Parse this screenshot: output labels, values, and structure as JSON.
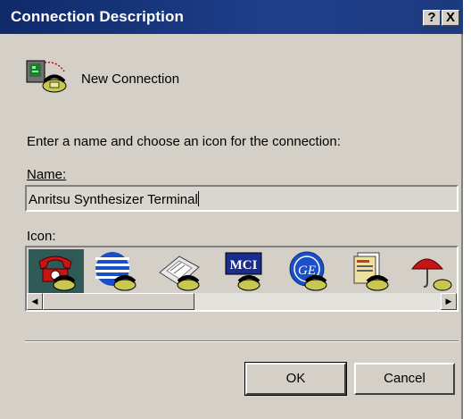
{
  "window": {
    "title": "Connection Description",
    "help_button": "?",
    "close_button": "X"
  },
  "header": {
    "label": "New Connection"
  },
  "form": {
    "prompt": "Enter a name and choose an icon for the connection:",
    "name_label": "Name:",
    "name_value": "Anritsu Synthesizer Terminal",
    "icon_label": "Icon:"
  },
  "icons": [
    {
      "name": "red-phone-icon",
      "selected": true
    },
    {
      "name": "globe-phone-icon",
      "selected": false
    },
    {
      "name": "fax-phone-icon",
      "selected": false
    },
    {
      "name": "mci-phone-icon",
      "selected": false
    },
    {
      "name": "ge-phone-icon",
      "selected": false
    },
    {
      "name": "documents-phone-icon",
      "selected": false
    },
    {
      "name": "umbrella-phone-icon",
      "selected": false
    }
  ],
  "mci_text": "MCI",
  "ge_text": "GE",
  "buttons": {
    "ok": "OK",
    "cancel": "Cancel"
  },
  "colors": {
    "titlebar": "#102a6a",
    "dialog_bg": "#d4d0c8",
    "selection": "#2f5a58"
  }
}
